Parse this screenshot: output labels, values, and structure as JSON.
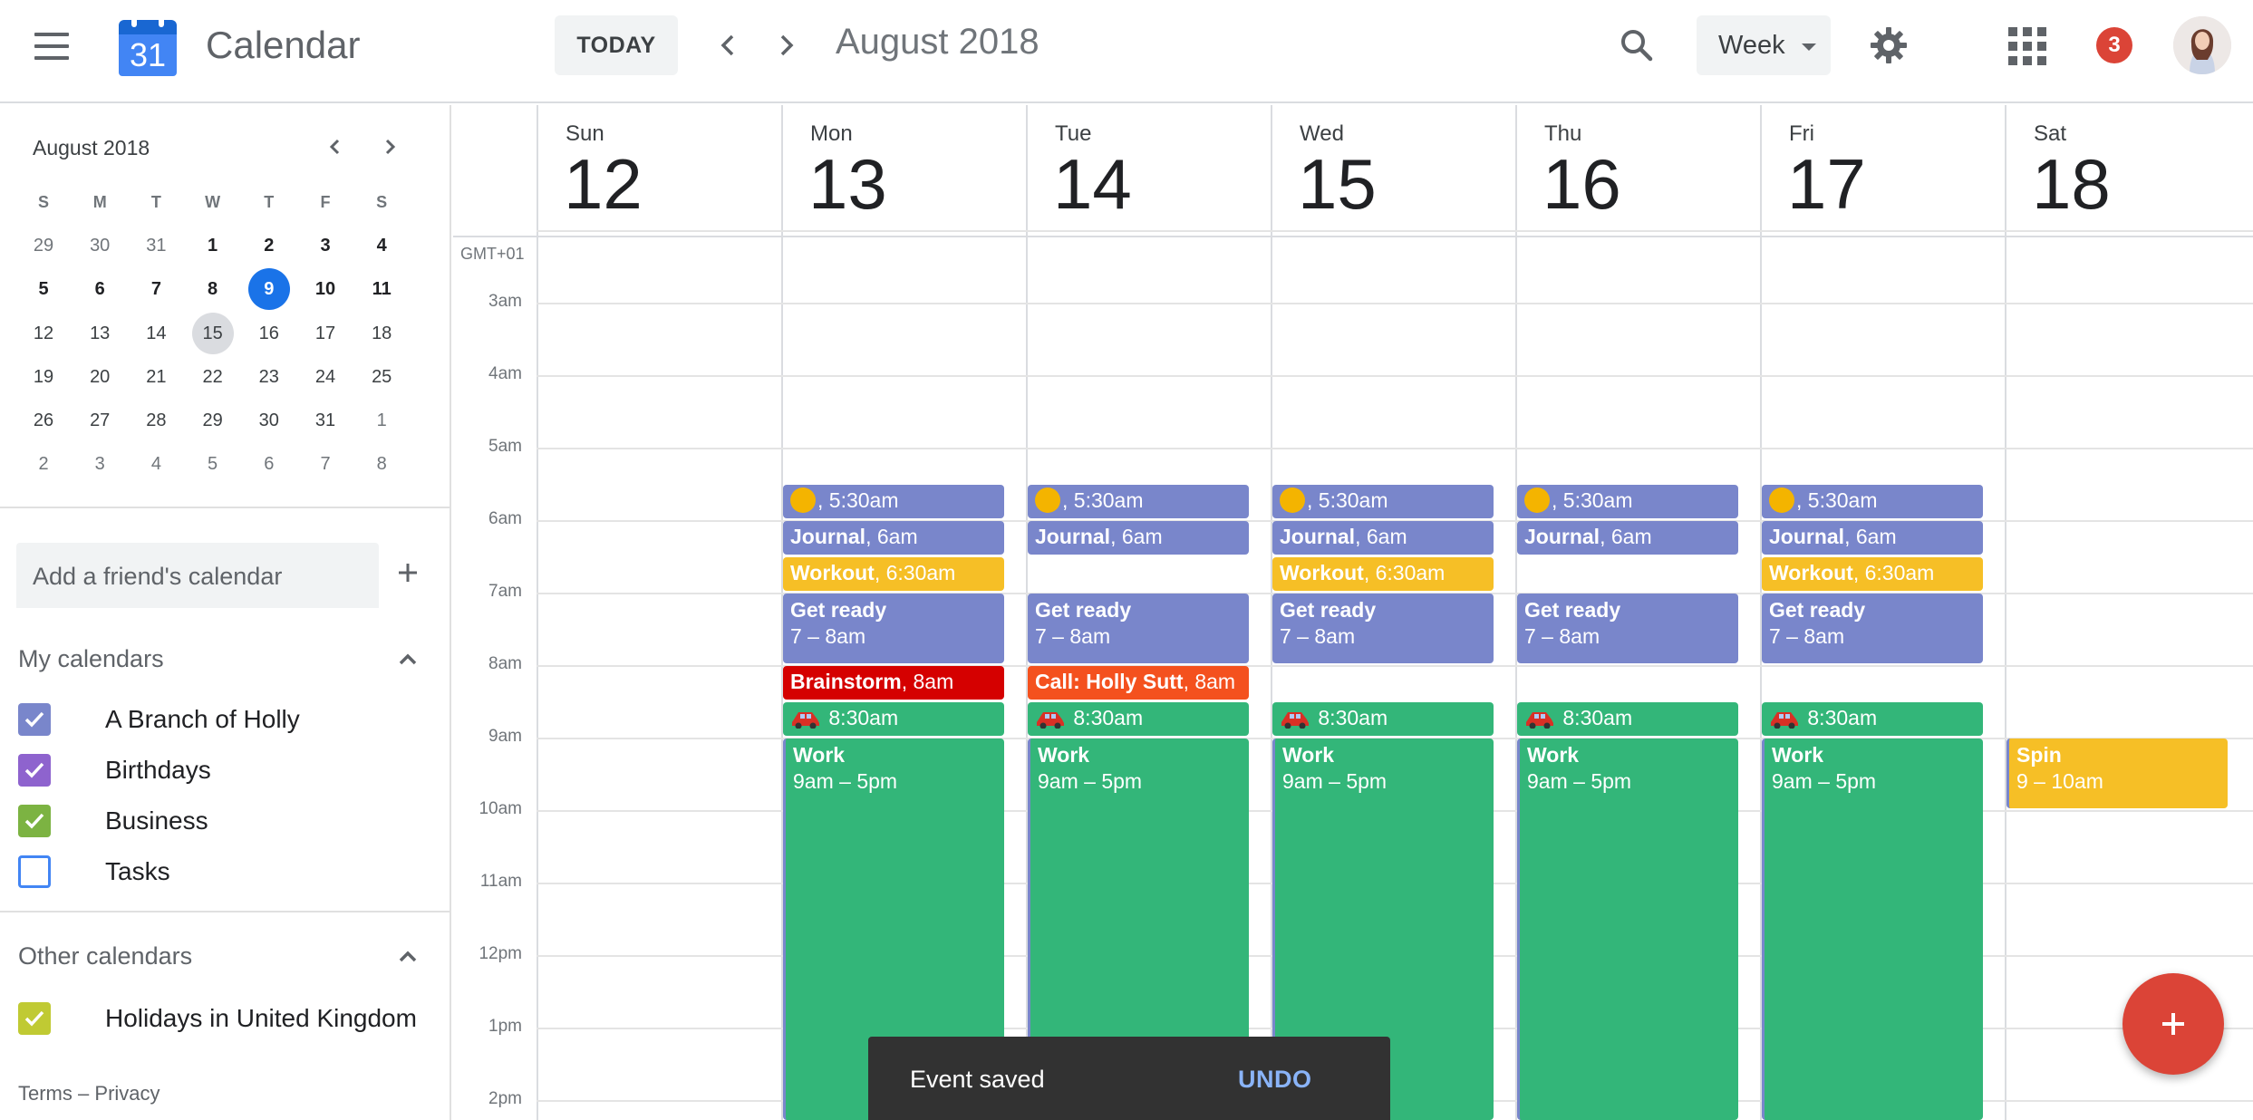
{
  "header": {
    "logo_number": "31",
    "app_title": "Calendar",
    "today_label": "TODAY",
    "month_title": "August 2018",
    "view_label": "Week",
    "notification_count": "3"
  },
  "mini_calendar": {
    "title": "August 2018",
    "weekday_headers": [
      "S",
      "M",
      "T",
      "W",
      "T",
      "F",
      "S"
    ],
    "weeks": [
      [
        "29",
        "30",
        "31",
        "1",
        "2",
        "3",
        "4"
      ],
      [
        "5",
        "6",
        "7",
        "8",
        "9",
        "10",
        "11"
      ],
      [
        "12",
        "13",
        "14",
        "15",
        "16",
        "17",
        "18"
      ],
      [
        "19",
        "20",
        "21",
        "22",
        "23",
        "24",
        "25"
      ],
      [
        "26",
        "27",
        "28",
        "29",
        "30",
        "31",
        "1"
      ],
      [
        "2",
        "3",
        "4",
        "5",
        "6",
        "7",
        "8"
      ]
    ],
    "today": "9",
    "selected": "15"
  },
  "sidebar": {
    "friend_placeholder": "Add a friend's calendar",
    "my_calendars_title": "My calendars",
    "my_calendars": [
      {
        "label": "A Branch of Holly",
        "color": "#7986cb",
        "checked": true
      },
      {
        "label": "Birthdays",
        "color": "#8e63ce",
        "checked": true
      },
      {
        "label": "Business",
        "color": "#7cb342",
        "checked": true
      },
      {
        "label": "Tasks",
        "color": "#4285f4",
        "checked": false
      }
    ],
    "other_calendars_title": "Other calendars",
    "other_calendars": [
      {
        "label": "Holidays in United Kingdom",
        "color": "#c0ca33",
        "checked": true
      }
    ],
    "footer_terms": "Terms",
    "footer_sep": "–",
    "footer_privacy": "Privacy"
  },
  "week": {
    "timezone": "GMT+01",
    "days": [
      {
        "name": "Sun",
        "date": "12"
      },
      {
        "name": "Mon",
        "date": "13"
      },
      {
        "name": "Tue",
        "date": "14"
      },
      {
        "name": "Wed",
        "date": "15"
      },
      {
        "name": "Thu",
        "date": "16"
      },
      {
        "name": "Fri",
        "date": "17"
      },
      {
        "name": "Sat",
        "date": "18"
      }
    ],
    "hours": [
      "3am",
      "4am",
      "5am",
      "6am",
      "7am",
      "8am",
      "9am",
      "10am",
      "11am",
      "12pm",
      "1pm",
      "2pm"
    ]
  },
  "events": [
    {
      "day": 1,
      "kind": "sun",
      "title": "",
      "time": ", 5:30am",
      "color": "#7986cb"
    },
    {
      "day": 1,
      "kind": "single",
      "title": "Journal",
      "time": ", 6am",
      "color": "#7986cb"
    },
    {
      "day": 1,
      "kind": "single",
      "title": "Workout",
      "time": ", 6:30am",
      "color": "#f6bf26"
    },
    {
      "day": 1,
      "kind": "block",
      "title": "Get ready",
      "time": "7 – 8am",
      "color": "#7986cb"
    },
    {
      "day": 1,
      "kind": "single",
      "title": "Brainstorm",
      "time": ", 8am",
      "color": "#d50000"
    },
    {
      "day": 1,
      "kind": "car",
      "title": "",
      "time": " 8:30am",
      "color": "#33b679"
    },
    {
      "day": 1,
      "kind": "block",
      "title": "Work",
      "time": "9am – 5pm",
      "color": "#33b679"
    },
    {
      "day": 2,
      "kind": "sun",
      "title": "",
      "time": ", 5:30am",
      "color": "#7986cb"
    },
    {
      "day": 2,
      "kind": "single",
      "title": "Journal",
      "time": ", 6am",
      "color": "#7986cb"
    },
    {
      "day": 2,
      "kind": "block",
      "title": "Get ready",
      "time": "7 – 8am",
      "color": "#7986cb"
    },
    {
      "day": 2,
      "kind": "single",
      "title": "Call: Holly Sutt",
      "time": ", 8am",
      "color": "#f4511e"
    },
    {
      "day": 2,
      "kind": "car",
      "title": "",
      "time": " 8:30am",
      "color": "#33b679"
    },
    {
      "day": 2,
      "kind": "block",
      "title": "Work",
      "time": "9am – 5pm",
      "color": "#33b679"
    },
    {
      "day": 3,
      "kind": "sun",
      "title": "",
      "time": ", 5:30am",
      "color": "#7986cb"
    },
    {
      "day": 3,
      "kind": "single",
      "title": "Journal",
      "time": ", 6am",
      "color": "#7986cb"
    },
    {
      "day": 3,
      "kind": "single",
      "title": "Workout",
      "time": ", 6:30am",
      "color": "#f6bf26"
    },
    {
      "day": 3,
      "kind": "block",
      "title": "Get ready",
      "time": "7 – 8am",
      "color": "#7986cb"
    },
    {
      "day": 3,
      "kind": "car",
      "title": "",
      "time": " 8:30am",
      "color": "#33b679"
    },
    {
      "day": 3,
      "kind": "block",
      "title": "Work",
      "time": "9am – 5pm",
      "color": "#33b679"
    },
    {
      "day": 4,
      "kind": "sun",
      "title": "",
      "time": ", 5:30am",
      "color": "#7986cb"
    },
    {
      "day": 4,
      "kind": "single",
      "title": "Journal",
      "time": ", 6am",
      "color": "#7986cb"
    },
    {
      "day": 4,
      "kind": "block",
      "title": "Get ready",
      "time": "7 – 8am",
      "color": "#7986cb"
    },
    {
      "day": 4,
      "kind": "car",
      "title": "",
      "time": " 8:30am",
      "color": "#33b679"
    },
    {
      "day": 4,
      "kind": "block",
      "title": "Work",
      "time": "9am – 5pm",
      "color": "#33b679"
    },
    {
      "day": 5,
      "kind": "sun",
      "title": "",
      "time": ", 5:30am",
      "color": "#7986cb"
    },
    {
      "day": 5,
      "kind": "single",
      "title": "Journal",
      "time": ", 6am",
      "color": "#7986cb"
    },
    {
      "day": 5,
      "kind": "single",
      "title": "Workout",
      "time": ", 6:30am",
      "color": "#f6bf26"
    },
    {
      "day": 5,
      "kind": "block",
      "title": "Get ready",
      "time": "7 – 8am",
      "color": "#7986cb"
    },
    {
      "day": 5,
      "kind": "car",
      "title": "",
      "time": " 8:30am",
      "color": "#33b679"
    },
    {
      "day": 5,
      "kind": "block",
      "title": "Work",
      "time": "9am – 5pm",
      "color": "#33b679"
    },
    {
      "day": 6,
      "kind": "block",
      "title": "Spin",
      "time": "9 – 10am",
      "color": "#f6bf26"
    }
  ],
  "snackbar": {
    "message": "Event saved",
    "action": "UNDO"
  }
}
